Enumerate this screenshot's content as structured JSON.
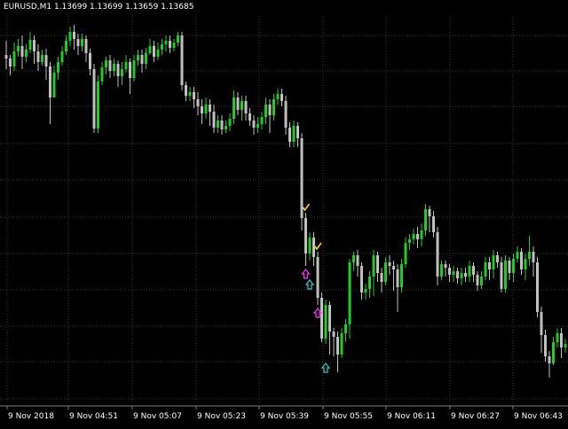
{
  "window": {
    "title": "EURUSD,M1  1.13699 1.13699 1.13659 1.13685"
  },
  "colors": {
    "background": "#000000",
    "grid": "#3a3a3a",
    "bull": "#22cc22",
    "bear": "#c0c0c0",
    "axis_text": "#ffffff",
    "check": "#ffd21a",
    "arrow_sell": "#ff33ff",
    "arrow_buy": "#33cccc"
  },
  "chart_data": {
    "type": "candlestick",
    "symbol": "EURUSD",
    "timeframe": "M1",
    "x_tick_labels": [
      "9 Nov 2018",
      "9 Nov 04:51",
      "9 Nov 05:07",
      "9 Nov 05:23",
      "9 Nov 05:39",
      "9 Nov 05:55",
      "9 Nov 06:11",
      "9 Nov 06:27",
      "9 Nov 06:43"
    ],
    "grid": true,
    "markers": [
      {
        "type": "check-icon",
        "index": 75
      },
      {
        "type": "arrow-up-magenta-icon",
        "index": 75
      },
      {
        "type": "arrow-up-cyan-icon",
        "index": 76
      },
      {
        "type": "check-icon",
        "index": 78
      },
      {
        "type": "arrow-up-magenta-icon",
        "index": 78
      },
      {
        "type": "arrow-up-cyan-icon",
        "index": 80
      }
    ],
    "candles": [
      [
        62,
        66,
        46,
        78
      ],
      [
        66,
        75,
        62,
        85
      ],
      [
        75,
        58,
        48,
        80
      ],
      [
        58,
        52,
        44,
        64
      ],
      [
        52,
        64,
        40,
        78
      ],
      [
        64,
        56,
        50,
        70
      ],
      [
        56,
        45,
        36,
        60
      ],
      [
        45,
        58,
        40,
        72
      ],
      [
        58,
        70,
        50,
        80
      ],
      [
        70,
        62,
        56,
        74
      ],
      [
        62,
        75,
        55,
        90
      ],
      [
        75,
        110,
        70,
        140
      ],
      [
        110,
        82,
        74,
        100
      ],
      [
        82,
        70,
        64,
        90
      ],
      [
        70,
        58,
        52,
        74
      ],
      [
        58,
        46,
        40,
        62
      ],
      [
        46,
        36,
        30,
        52
      ],
      [
        36,
        44,
        28,
        56
      ],
      [
        44,
        52,
        38,
        62
      ],
      [
        52,
        44,
        38,
        58
      ],
      [
        44,
        60,
        40,
        70
      ],
      [
        60,
        78,
        55,
        85
      ],
      [
        78,
        145,
        72,
        150
      ],
      [
        145,
        92,
        85,
        150
      ],
      [
        92,
        76,
        70,
        96
      ],
      [
        76,
        68,
        64,
        84
      ],
      [
        68,
        80,
        62,
        88
      ],
      [
        80,
        72,
        66,
        86
      ],
      [
        72,
        86,
        68,
        98
      ],
      [
        86,
        78,
        70,
        96
      ],
      [
        78,
        70,
        62,
        82
      ],
      [
        70,
        88,
        66,
        106
      ],
      [
        88,
        68,
        62,
        92
      ],
      [
        68,
        62,
        56,
        74
      ],
      [
        62,
        72,
        56,
        82
      ],
      [
        72,
        60,
        54,
        78
      ],
      [
        60,
        52,
        44,
        62
      ],
      [
        52,
        64,
        46,
        70
      ],
      [
        64,
        56,
        48,
        68
      ],
      [
        56,
        50,
        44,
        62
      ],
      [
        50,
        46,
        40,
        58
      ],
      [
        46,
        54,
        40,
        60
      ],
      [
        54,
        48,
        44,
        58
      ],
      [
        48,
        40,
        36,
        52
      ],
      [
        40,
        96,
        36,
        102
      ],
      [
        96,
        108,
        92,
        114
      ],
      [
        108,
        104,
        98,
        114
      ],
      [
        104,
        112,
        98,
        122
      ],
      [
        112,
        120,
        104,
        130
      ],
      [
        120,
        128,
        112,
        140
      ],
      [
        128,
        118,
        110,
        134
      ],
      [
        118,
        126,
        112,
        142
      ],
      [
        126,
        144,
        118,
        150
      ],
      [
        144,
        136,
        130,
        150
      ],
      [
        136,
        146,
        130,
        152
      ],
      [
        146,
        142,
        136,
        150
      ],
      [
        142,
        134,
        128,
        148
      ],
      [
        134,
        110,
        102,
        140
      ],
      [
        110,
        124,
        104,
        130
      ],
      [
        124,
        114,
        108,
        136
      ],
      [
        114,
        128,
        108,
        136
      ],
      [
        128,
        136,
        122,
        142
      ],
      [
        136,
        144,
        130,
        152
      ],
      [
        144,
        140,
        132,
        150
      ],
      [
        140,
        132,
        126,
        146
      ],
      [
        132,
        118,
        110,
        140
      ],
      [
        118,
        130,
        112,
        150
      ],
      [
        130,
        112,
        106,
        136
      ],
      [
        112,
        106,
        100,
        118
      ],
      [
        106,
        114,
        100,
        120
      ],
      [
        114,
        144,
        108,
        152
      ],
      [
        144,
        160,
        138,
        166
      ],
      [
        160,
        142,
        136,
        166
      ],
      [
        142,
        156,
        138,
        166
      ],
      [
        156,
        246,
        150,
        260
      ],
      [
        246,
        286,
        240,
        300
      ],
      [
        286,
        268,
        262,
        294
      ],
      [
        268,
        290,
        262,
        300
      ],
      [
        290,
        336,
        284,
        344
      ],
      [
        336,
        382,
        330,
        386
      ],
      [
        382,
        344,
        338,
        388
      ],
      [
        344,
        374,
        340,
        400
      ],
      [
        374,
        380,
        370,
        402
      ],
      [
        380,
        400,
        374,
        420
      ],
      [
        400,
        376,
        370,
        404
      ],
      [
        376,
        366,
        360,
        386
      ],
      [
        366,
        296,
        292,
        382
      ],
      [
        296,
        288,
        284,
        306
      ],
      [
        288,
        300,
        282,
        312
      ],
      [
        300,
        330,
        296,
        338
      ],
      [
        330,
        326,
        320,
        338
      ],
      [
        326,
        312,
        306,
        336
      ],
      [
        312,
        288,
        282,
        334
      ],
      [
        288,
        308,
        284,
        318
      ],
      [
        308,
        318,
        302,
        330
      ],
      [
        318,
        296,
        290,
        322
      ],
      [
        296,
        300,
        288,
        310
      ],
      [
        300,
        304,
        294,
        328
      ],
      [
        304,
        324,
        298,
        352
      ],
      [
        324,
        298,
        292,
        330
      ],
      [
        298,
        274,
        268,
        302
      ],
      [
        274,
        270,
        264,
        282
      ],
      [
        270,
        264,
        258,
        276
      ],
      [
        264,
        270,
        256,
        280
      ],
      [
        270,
        260,
        252,
        278
      ],
      [
        260,
        236,
        230,
        266
      ],
      [
        236,
        244,
        232,
        262
      ],
      [
        244,
        262,
        238,
        268
      ],
      [
        262,
        312,
        256,
        322
      ],
      [
        312,
        298,
        294,
        316
      ],
      [
        298,
        302,
        294,
        312
      ],
      [
        302,
        310,
        298,
        318
      ],
      [
        310,
        306,
        300,
        318
      ],
      [
        306,
        314,
        302,
        320
      ],
      [
        314,
        308,
        302,
        322
      ],
      [
        308,
        312,
        302,
        318
      ],
      [
        312,
        300,
        294,
        318
      ],
      [
        300,
        310,
        296,
        318
      ],
      [
        310,
        322,
        306,
        328
      ],
      [
        322,
        312,
        306,
        326
      ],
      [
        312,
        296,
        290,
        316
      ],
      [
        296,
        304,
        290,
        316
      ],
      [
        304,
        288,
        282,
        314
      ],
      [
        288,
        296,
        284,
        302
      ],
      [
        296,
        326,
        290,
        330
      ],
      [
        326,
        294,
        288,
        330
      ],
      [
        294,
        308,
        290,
        316
      ],
      [
        308,
        292,
        286,
        318
      ],
      [
        292,
        284,
        278,
        296
      ],
      [
        284,
        304,
        280,
        310
      ],
      [
        304,
        292,
        286,
        316
      ],
      [
        292,
        284,
        266,
        300
      ],
      [
        284,
        296,
        278,
        312
      ],
      [
        296,
        352,
        290,
        358
      ],
      [
        352,
        378,
        346,
        398
      ],
      [
        378,
        402,
        372,
        408
      ],
      [
        402,
        410,
        396,
        426
      ],
      [
        410,
        386,
        380,
        412
      ],
      [
        386,
        376,
        370,
        392
      ],
      [
        376,
        392,
        370,
        404
      ],
      [
        392,
        388,
        382,
        398
      ],
      [
        388,
        382,
        376,
        396
      ],
      [
        382,
        370,
        364,
        386
      ],
      [
        370,
        360,
        354,
        374
      ],
      [
        360,
        350,
        344,
        366
      ],
      [
        350,
        312,
        304,
        356
      ],
      [
        312,
        284,
        276,
        320
      ]
    ]
  }
}
